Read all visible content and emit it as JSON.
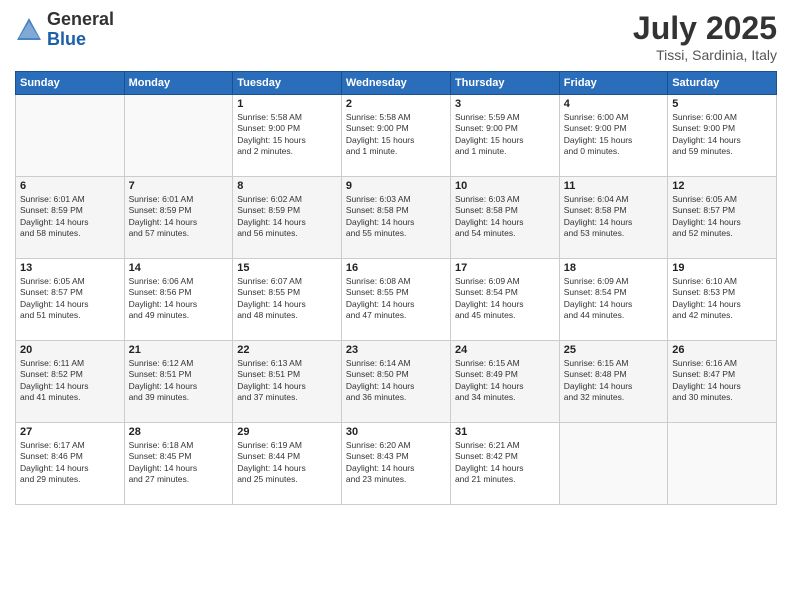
{
  "header": {
    "logo_general": "General",
    "logo_blue": "Blue",
    "month_title": "July 2025",
    "location": "Tissi, Sardinia, Italy"
  },
  "days_of_week": [
    "Sunday",
    "Monday",
    "Tuesday",
    "Wednesday",
    "Thursday",
    "Friday",
    "Saturday"
  ],
  "weeks": [
    [
      {
        "day": "",
        "info": ""
      },
      {
        "day": "",
        "info": ""
      },
      {
        "day": "1",
        "info": "Sunrise: 5:58 AM\nSunset: 9:00 PM\nDaylight: 15 hours\nand 2 minutes."
      },
      {
        "day": "2",
        "info": "Sunrise: 5:58 AM\nSunset: 9:00 PM\nDaylight: 15 hours\nand 1 minute."
      },
      {
        "day": "3",
        "info": "Sunrise: 5:59 AM\nSunset: 9:00 PM\nDaylight: 15 hours\nand 1 minute."
      },
      {
        "day": "4",
        "info": "Sunrise: 6:00 AM\nSunset: 9:00 PM\nDaylight: 15 hours\nand 0 minutes."
      },
      {
        "day": "5",
        "info": "Sunrise: 6:00 AM\nSunset: 9:00 PM\nDaylight: 14 hours\nand 59 minutes."
      }
    ],
    [
      {
        "day": "6",
        "info": "Sunrise: 6:01 AM\nSunset: 8:59 PM\nDaylight: 14 hours\nand 58 minutes."
      },
      {
        "day": "7",
        "info": "Sunrise: 6:01 AM\nSunset: 8:59 PM\nDaylight: 14 hours\nand 57 minutes."
      },
      {
        "day": "8",
        "info": "Sunrise: 6:02 AM\nSunset: 8:59 PM\nDaylight: 14 hours\nand 56 minutes."
      },
      {
        "day": "9",
        "info": "Sunrise: 6:03 AM\nSunset: 8:58 PM\nDaylight: 14 hours\nand 55 minutes."
      },
      {
        "day": "10",
        "info": "Sunrise: 6:03 AM\nSunset: 8:58 PM\nDaylight: 14 hours\nand 54 minutes."
      },
      {
        "day": "11",
        "info": "Sunrise: 6:04 AM\nSunset: 8:58 PM\nDaylight: 14 hours\nand 53 minutes."
      },
      {
        "day": "12",
        "info": "Sunrise: 6:05 AM\nSunset: 8:57 PM\nDaylight: 14 hours\nand 52 minutes."
      }
    ],
    [
      {
        "day": "13",
        "info": "Sunrise: 6:05 AM\nSunset: 8:57 PM\nDaylight: 14 hours\nand 51 minutes."
      },
      {
        "day": "14",
        "info": "Sunrise: 6:06 AM\nSunset: 8:56 PM\nDaylight: 14 hours\nand 49 minutes."
      },
      {
        "day": "15",
        "info": "Sunrise: 6:07 AM\nSunset: 8:55 PM\nDaylight: 14 hours\nand 48 minutes."
      },
      {
        "day": "16",
        "info": "Sunrise: 6:08 AM\nSunset: 8:55 PM\nDaylight: 14 hours\nand 47 minutes."
      },
      {
        "day": "17",
        "info": "Sunrise: 6:09 AM\nSunset: 8:54 PM\nDaylight: 14 hours\nand 45 minutes."
      },
      {
        "day": "18",
        "info": "Sunrise: 6:09 AM\nSunset: 8:54 PM\nDaylight: 14 hours\nand 44 minutes."
      },
      {
        "day": "19",
        "info": "Sunrise: 6:10 AM\nSunset: 8:53 PM\nDaylight: 14 hours\nand 42 minutes."
      }
    ],
    [
      {
        "day": "20",
        "info": "Sunrise: 6:11 AM\nSunset: 8:52 PM\nDaylight: 14 hours\nand 41 minutes."
      },
      {
        "day": "21",
        "info": "Sunrise: 6:12 AM\nSunset: 8:51 PM\nDaylight: 14 hours\nand 39 minutes."
      },
      {
        "day": "22",
        "info": "Sunrise: 6:13 AM\nSunset: 8:51 PM\nDaylight: 14 hours\nand 37 minutes."
      },
      {
        "day": "23",
        "info": "Sunrise: 6:14 AM\nSunset: 8:50 PM\nDaylight: 14 hours\nand 36 minutes."
      },
      {
        "day": "24",
        "info": "Sunrise: 6:15 AM\nSunset: 8:49 PM\nDaylight: 14 hours\nand 34 minutes."
      },
      {
        "day": "25",
        "info": "Sunrise: 6:15 AM\nSunset: 8:48 PM\nDaylight: 14 hours\nand 32 minutes."
      },
      {
        "day": "26",
        "info": "Sunrise: 6:16 AM\nSunset: 8:47 PM\nDaylight: 14 hours\nand 30 minutes."
      }
    ],
    [
      {
        "day": "27",
        "info": "Sunrise: 6:17 AM\nSunset: 8:46 PM\nDaylight: 14 hours\nand 29 minutes."
      },
      {
        "day": "28",
        "info": "Sunrise: 6:18 AM\nSunset: 8:45 PM\nDaylight: 14 hours\nand 27 minutes."
      },
      {
        "day": "29",
        "info": "Sunrise: 6:19 AM\nSunset: 8:44 PM\nDaylight: 14 hours\nand 25 minutes."
      },
      {
        "day": "30",
        "info": "Sunrise: 6:20 AM\nSunset: 8:43 PM\nDaylight: 14 hours\nand 23 minutes."
      },
      {
        "day": "31",
        "info": "Sunrise: 6:21 AM\nSunset: 8:42 PM\nDaylight: 14 hours\nand 21 minutes."
      },
      {
        "day": "",
        "info": ""
      },
      {
        "day": "",
        "info": ""
      }
    ]
  ]
}
